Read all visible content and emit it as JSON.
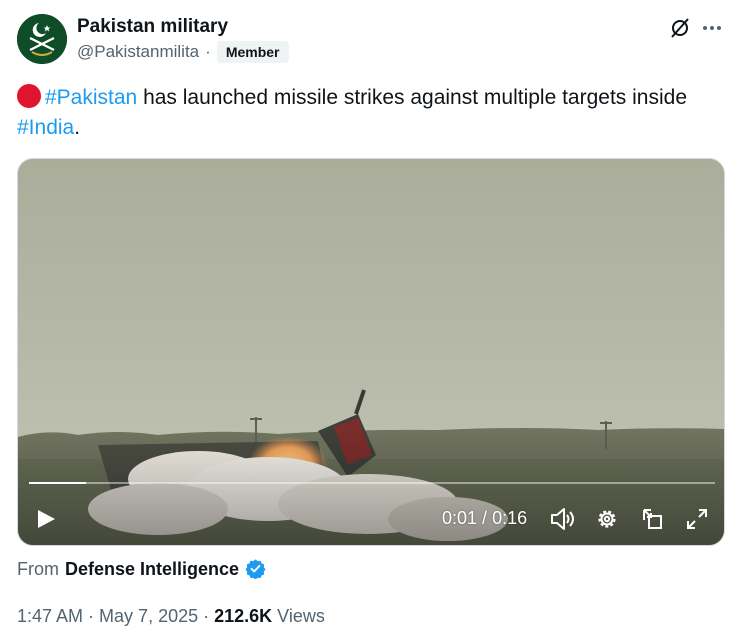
{
  "author": {
    "display_name": "Pakistan military",
    "handle": "@Pakistanmilita",
    "separator": "·",
    "badge": "Member",
    "avatar_icon": "pakistan-army-emblem-icon"
  },
  "header_actions": {
    "grok_icon": "grok-slash-icon",
    "more_icon": "more-dots-icon"
  },
  "post": {
    "emoji": "red-circle",
    "hashtag_1": "#Pakistan",
    "text_main": " has launched missile strikes against multiple targets inside ",
    "hashtag_2": "#India",
    "text_end": "."
  },
  "video": {
    "current_time": "0:01",
    "duration": "0:16",
    "time_separator": " / ",
    "progress": 0.083,
    "controls": [
      "play-icon",
      "volume-icon",
      "settings-icon",
      "pop-out-icon",
      "fullscreen-icon"
    ]
  },
  "source": {
    "from_label": "From",
    "name": "Defense Intelligence",
    "verified": true
  },
  "meta": {
    "time": "1:47 AM",
    "date": "May 7, 2025",
    "separator": " · ",
    "views_count": "212.6K",
    "views_label": " Views"
  },
  "colors": {
    "link": "#1d9bf0",
    "secondary_text": "#536471",
    "verified": "#1d9bf0",
    "red_dot": "#e0142e"
  }
}
